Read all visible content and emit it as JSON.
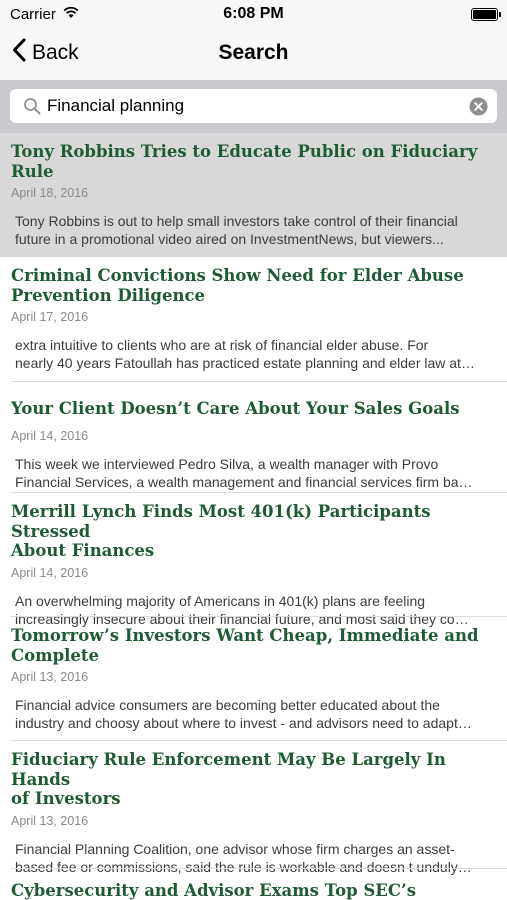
{
  "status_bar": {
    "carrier": "Carrier",
    "time": "6:08 PM",
    "icons": [
      "wifi-icon",
      "battery-icon"
    ]
  },
  "nav": {
    "back_label": "Back",
    "title": "Search"
  },
  "search": {
    "value": "Financial planning",
    "icons": [
      "search-icon",
      "clear-icon"
    ]
  },
  "articles": [
    {
      "title_line1": "Tony Robbins Tries to Educate Public on Fiduciary",
      "title_line2": "Rule",
      "date": "April 18, 2016",
      "snippet_line1": "Tony Robbins is out to help small investors take control of their financial",
      "snippet_line2": "future in a promotional video aired on InvestmentNews, but viewers..."
    },
    {
      "title_line1": "Criminal Convictions Show Need for Elder Abuse",
      "title_line2": "Prevention Diligence",
      "date": "April 17, 2016",
      "snippet_line1": "extra intuitive to clients who are at risk of financial elder abuse.  For",
      "snippet_line2": "nearly 40 years Fatoullah has practiced estate planning and elder law at…"
    },
    {
      "title_line1": "Your Client Doesn’t Care About Your Sales Goals",
      "title_line2": "",
      "date": "April 14, 2016",
      "snippet_line1": "This week we interviewed Pedro Silva, a wealth manager with Provo",
      "snippet_line2": "Financial Services, a wealth management and financial services firm ba…"
    },
    {
      "title_line1": "Merrill Lynch Finds Most 401(k) Participants Stressed",
      "title_line2": "About Finances",
      "date": "April 14, 2016",
      "snippet_line1": "An overwhelming majority of Americans in 401(k) plans are feeling",
      "snippet_line2": "increasingly insecure about their financial future, and most said they co…"
    },
    {
      "title_line1": "Tomorrow’s Investors Want Cheap, Immediate and",
      "title_line2": "Complete",
      "date": "April 13, 2016",
      "snippet_line1": "Financial advice consumers are becoming better educated about the",
      "snippet_line2": "industry and choosy about where to invest - and advisors need to adapt…"
    },
    {
      "title_line1": "Fiduciary Rule Enforcement May Be Largely In Hands",
      "title_line2": "of Investors",
      "date": "April 13, 2016",
      "snippet_line1": "Financial Planning Coalition, one advisor whose firm charges an asset-",
      "snippet_line2": "based fee or commissions, said the rule is workable and doesn t unduly…"
    },
    {
      "title_line1": "Cybersecurity and Advisor Exams Top SEC’s Priorities",
      "title_line2": "",
      "date": "",
      "snippet_line1": "",
      "snippet_line2": ""
    }
  ],
  "colors": {
    "title_green": "#1e5b33",
    "highlight": "#d8d8d8",
    "search_bar_bg": "#c9c9ce"
  }
}
